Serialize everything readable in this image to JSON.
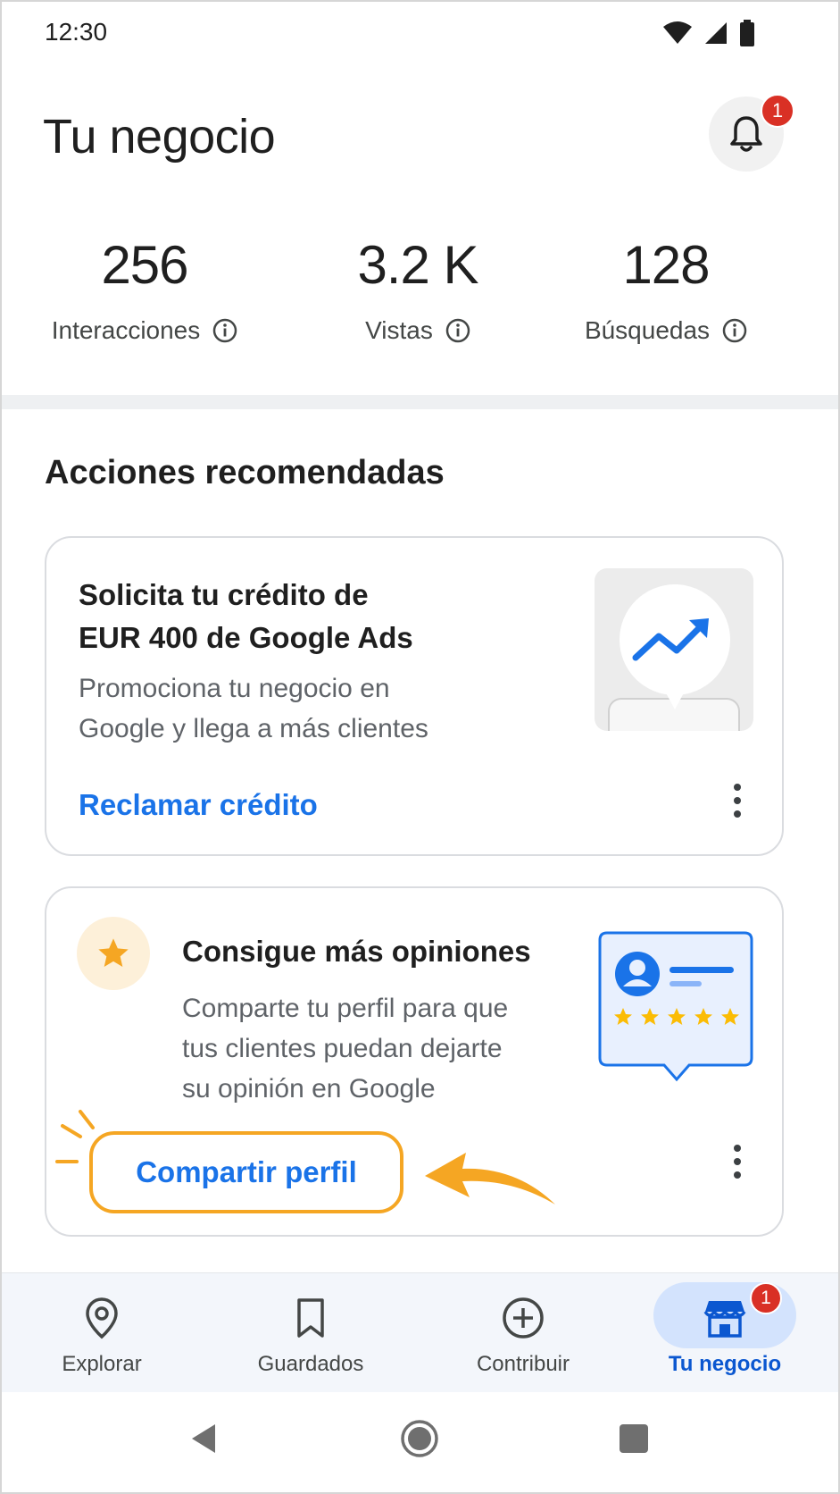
{
  "status_bar": {
    "time": "12:30"
  },
  "header": {
    "title": "Tu negocio",
    "notification_count": "1"
  },
  "stats": [
    {
      "value": "256",
      "label": "Interacciones"
    },
    {
      "value": "3.2 K",
      "label": "Vistas"
    },
    {
      "value": "128",
      "label": "Búsquedas"
    }
  ],
  "section": {
    "title": "Acciones recomendadas"
  },
  "card_credit": {
    "title_line1": "Solicita tu crédito de",
    "title_line2": "EUR 400 de Google Ads",
    "desc_line1": "Promociona tu negocio en",
    "desc_line2": "Google y llega a más clientes",
    "link": "Reclamar crédito"
  },
  "card_reviews": {
    "title": "Consigue más opiniones",
    "desc_line1": "Comparte tu perfil para que",
    "desc_line2": "tus clientes puedan dejarte",
    "desc_line3": "su opinión en Google",
    "button": "Compartir perfil"
  },
  "bottom_nav": {
    "items": [
      {
        "label": "Explorar",
        "icon": "location-pin-icon"
      },
      {
        "label": "Guardados",
        "icon": "bookmark-icon"
      },
      {
        "label": "Contribuir",
        "icon": "add-circle-icon"
      },
      {
        "label": "Tu negocio",
        "icon": "storefront-icon",
        "badge": "1",
        "active": true
      }
    ]
  },
  "colors": {
    "accent": "#1a73e8",
    "highlight": "#f5a623",
    "badge": "#d93025",
    "star": "#fbbc04"
  }
}
